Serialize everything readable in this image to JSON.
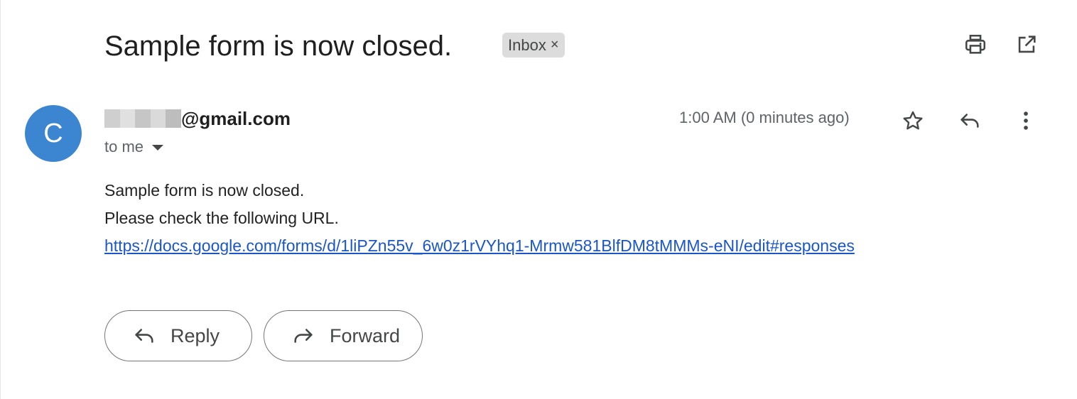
{
  "subject": {
    "title": "Sample form is now closed.",
    "label": "Inbox",
    "label_remove": "×"
  },
  "header_icons": [
    "printer-icon",
    "open-in-new-window-icon"
  ],
  "message": {
    "avatar_letter": "C",
    "sender_domain": "@gmail.com",
    "recipient": "to me",
    "timestamp": "1:00 AM (0 minutes ago)",
    "actions": [
      "star-icon",
      "reply-icon",
      "more-vert-icon"
    ],
    "body": {
      "line1": "Sample form is now closed.",
      "line2": "Please check the following URL.",
      "link": "https://docs.google.com/forms/d/1liPZn55v_6w0z1rVYhq1-Mrmw581BlfDM8tMMMs-eNI/edit#responses"
    }
  },
  "buttons": {
    "reply": "Reply",
    "forward": "Forward"
  },
  "colors": {
    "avatar_bg": "#3c86d1",
    "link": "#1a56c9",
    "chip_bg": "#dcdcdc"
  }
}
